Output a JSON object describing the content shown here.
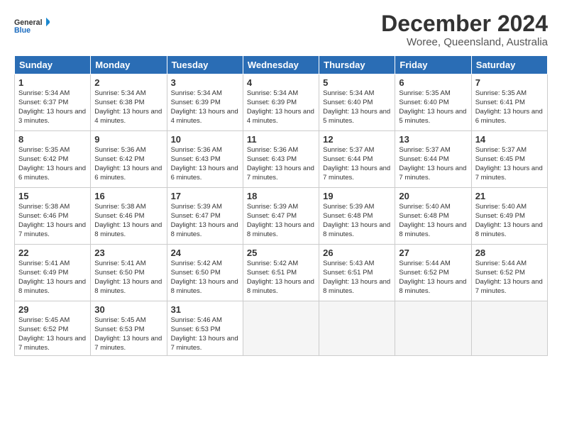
{
  "header": {
    "logo_line1": "General",
    "logo_line2": "Blue",
    "title": "December 2024",
    "subtitle": "Woree, Queensland, Australia"
  },
  "calendar": {
    "days_of_week": [
      "Sunday",
      "Monday",
      "Tuesday",
      "Wednesday",
      "Thursday",
      "Friday",
      "Saturday"
    ],
    "weeks": [
      [
        null,
        {
          "day": 2,
          "sunrise": "5:34 AM",
          "sunset": "6:38 PM",
          "daylight": "13 hours and 4 minutes."
        },
        {
          "day": 3,
          "sunrise": "5:34 AM",
          "sunset": "6:39 PM",
          "daylight": "13 hours and 4 minutes."
        },
        {
          "day": 4,
          "sunrise": "5:34 AM",
          "sunset": "6:39 PM",
          "daylight": "13 hours and 4 minutes."
        },
        {
          "day": 5,
          "sunrise": "5:34 AM",
          "sunset": "6:40 PM",
          "daylight": "13 hours and 5 minutes."
        },
        {
          "day": 6,
          "sunrise": "5:35 AM",
          "sunset": "6:40 PM",
          "daylight": "13 hours and 5 minutes."
        },
        {
          "day": 7,
          "sunrise": "5:35 AM",
          "sunset": "6:41 PM",
          "daylight": "13 hours and 6 minutes."
        }
      ],
      [
        {
          "day": 1,
          "sunrise": "5:34 AM",
          "sunset": "6:37 PM",
          "daylight": "13 hours and 3 minutes."
        },
        {
          "day": 8,
          "sunrise": "5:35 AM",
          "sunset": "6:42 PM",
          "daylight": "13 hours and 6 minutes."
        },
        {
          "day": 9,
          "sunrise": "5:36 AM",
          "sunset": "6:42 PM",
          "daylight": "13 hours and 6 minutes."
        },
        {
          "day": 10,
          "sunrise": "5:36 AM",
          "sunset": "6:43 PM",
          "daylight": "13 hours and 6 minutes."
        },
        {
          "day": 11,
          "sunrise": "5:36 AM",
          "sunset": "6:43 PM",
          "daylight": "13 hours and 7 minutes."
        },
        {
          "day": 12,
          "sunrise": "5:37 AM",
          "sunset": "6:44 PM",
          "daylight": "13 hours and 7 minutes."
        },
        {
          "day": 13,
          "sunrise": "5:37 AM",
          "sunset": "6:44 PM",
          "daylight": "13 hours and 7 minutes."
        },
        {
          "day": 14,
          "sunrise": "5:37 AM",
          "sunset": "6:45 PM",
          "daylight": "13 hours and 7 minutes."
        }
      ],
      [
        {
          "day": 15,
          "sunrise": "5:38 AM",
          "sunset": "6:46 PM",
          "daylight": "13 hours and 7 minutes."
        },
        {
          "day": 16,
          "sunrise": "5:38 AM",
          "sunset": "6:46 PM",
          "daylight": "13 hours and 8 minutes."
        },
        {
          "day": 17,
          "sunrise": "5:39 AM",
          "sunset": "6:47 PM",
          "daylight": "13 hours and 8 minutes."
        },
        {
          "day": 18,
          "sunrise": "5:39 AM",
          "sunset": "6:47 PM",
          "daylight": "13 hours and 8 minutes."
        },
        {
          "day": 19,
          "sunrise": "5:39 AM",
          "sunset": "6:48 PM",
          "daylight": "13 hours and 8 minutes."
        },
        {
          "day": 20,
          "sunrise": "5:40 AM",
          "sunset": "6:48 PM",
          "daylight": "13 hours and 8 minutes."
        },
        {
          "day": 21,
          "sunrise": "5:40 AM",
          "sunset": "6:49 PM",
          "daylight": "13 hours and 8 minutes."
        }
      ],
      [
        {
          "day": 22,
          "sunrise": "5:41 AM",
          "sunset": "6:49 PM",
          "daylight": "13 hours and 8 minutes."
        },
        {
          "day": 23,
          "sunrise": "5:41 AM",
          "sunset": "6:50 PM",
          "daylight": "13 hours and 8 minutes."
        },
        {
          "day": 24,
          "sunrise": "5:42 AM",
          "sunset": "6:50 PM",
          "daylight": "13 hours and 8 minutes."
        },
        {
          "day": 25,
          "sunrise": "5:42 AM",
          "sunset": "6:51 PM",
          "daylight": "13 hours and 8 minutes."
        },
        {
          "day": 26,
          "sunrise": "5:43 AM",
          "sunset": "6:51 PM",
          "daylight": "13 hours and 8 minutes."
        },
        {
          "day": 27,
          "sunrise": "5:44 AM",
          "sunset": "6:52 PM",
          "daylight": "13 hours and 8 minutes."
        },
        {
          "day": 28,
          "sunrise": "5:44 AM",
          "sunset": "6:52 PM",
          "daylight": "13 hours and 7 minutes."
        }
      ],
      [
        {
          "day": 29,
          "sunrise": "5:45 AM",
          "sunset": "6:52 PM",
          "daylight": "13 hours and 7 minutes."
        },
        {
          "day": 30,
          "sunrise": "5:45 AM",
          "sunset": "6:53 PM",
          "daylight": "13 hours and 7 minutes."
        },
        {
          "day": 31,
          "sunrise": "5:46 AM",
          "sunset": "6:53 PM",
          "daylight": "13 hours and 7 minutes."
        },
        null,
        null,
        null,
        null
      ]
    ]
  }
}
